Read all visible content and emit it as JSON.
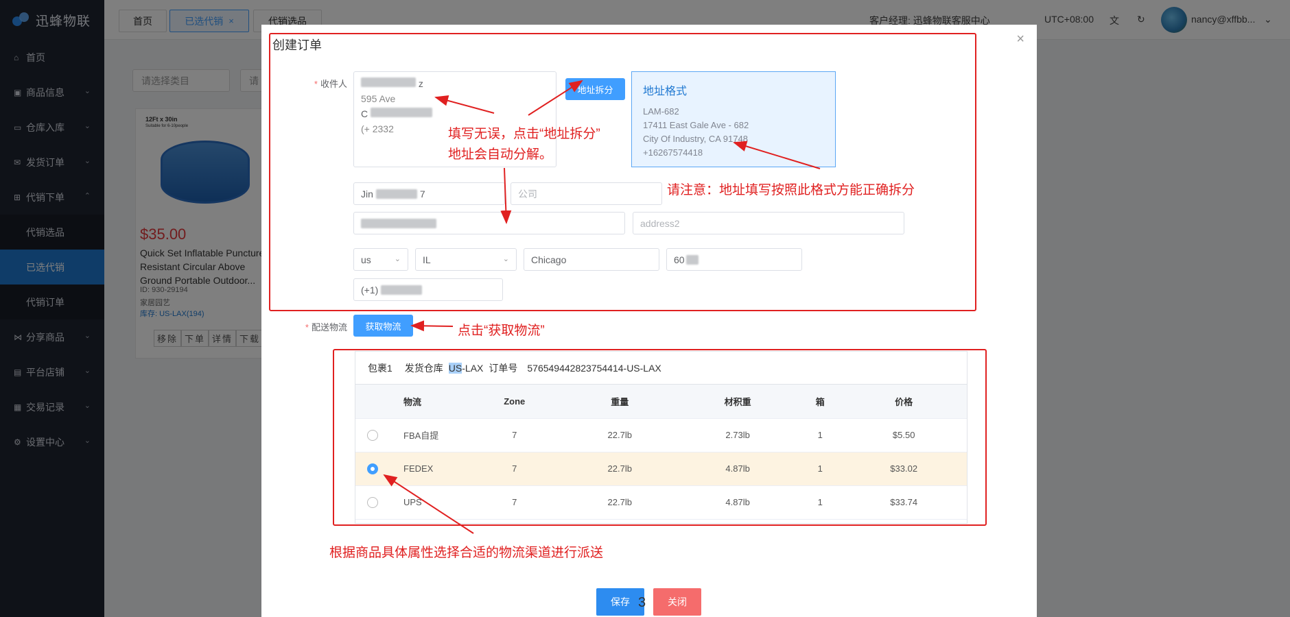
{
  "app": {
    "logo": "迅蜂物联"
  },
  "sidebar": {
    "items": [
      {
        "label": "首页",
        "icon": "home-icon"
      },
      {
        "label": "商品信息",
        "icon": "gift-icon"
      },
      {
        "label": "仓库入库",
        "icon": "folder-icon"
      },
      {
        "label": "发货订单",
        "icon": "mail-icon"
      },
      {
        "label": "代销下单",
        "icon": "cart-icon"
      }
    ],
    "subs": [
      {
        "label": "代销选品"
      },
      {
        "label": "已选代销"
      },
      {
        "label": "代销订单"
      }
    ],
    "items2": [
      {
        "label": "分享商品",
        "icon": "share-icon"
      },
      {
        "label": "平台店铺",
        "icon": "store-icon"
      },
      {
        "label": "交易记录",
        "icon": "document-icon"
      },
      {
        "label": "设置中心",
        "icon": "gear-icon"
      }
    ]
  },
  "topbar": {
    "tabs": [
      "首页",
      "已选代销",
      "代销选品"
    ],
    "manager": "客户经理: 迅蜂物联客服中心",
    "timezone": "UTC+08:00",
    "user": "nancy@xffbb...",
    "close_mark": "×"
  },
  "background": {
    "filter1": "请选择类目",
    "filter2": "请",
    "product": {
      "img_caption": "12Ft x 30in",
      "img_sub": "Suitable for 6-10people",
      "price": "$35.00",
      "title": "Quick Set Inflatable Puncture Resistant Circular Above Ground Portable Outdoor...",
      "id": "ID: 930-29194",
      "category": "家居园艺",
      "stock": "库存: US-LAX(194)",
      "actions": [
        "移除",
        "下单",
        "详情",
        "下载"
      ]
    }
  },
  "modal": {
    "title": "创建订单",
    "close": "×",
    "recipient_label": "收件人",
    "textarea_lines": [
      "z",
      "595          Ave",
      "C",
      "(+          2332"
    ],
    "split_button": "地址拆分",
    "format": {
      "title": "地址格式",
      "lines": [
        "LAM-682",
        "17411 East Gale Ave - 682",
        "City Of Industry, CA 91748",
        "+16267574418"
      ]
    },
    "name_prefix": "Jin",
    "name_suffix": "7",
    "company_placeholder": "公司",
    "address2_placeholder": "address2",
    "country": "us",
    "state": "IL",
    "city": "Chicago",
    "zip_prefix": "60",
    "phone_prefix": "(+1)",
    "shipping_label": "配送物流",
    "get_shipping_button": "获取物流",
    "package": {
      "parcel": "包裹1",
      "warehouse_label": "发货仓库",
      "warehouse_hl": "US",
      "warehouse_rest": "-LAX",
      "order_label": "订单号",
      "order_no": "576549442823754414-US-LAX"
    },
    "table": {
      "headers": [
        "物流",
        "Zone",
        "重量",
        "材积重",
        "箱",
        "价格"
      ],
      "rows": [
        {
          "carrier": "FBA自提",
          "zone": "7",
          "weight": "22.7lb",
          "vol": "2.73lb",
          "box": "1",
          "price": "$5.50",
          "selected": false
        },
        {
          "carrier": "FEDEX",
          "zone": "7",
          "weight": "22.7lb",
          "vol": "4.87lb",
          "box": "1",
          "price": "$33.02",
          "selected": true
        },
        {
          "carrier": "UPS",
          "zone": "7",
          "weight": "22.7lb",
          "vol": "4.87lb",
          "box": "1",
          "price": "$33.74",
          "selected": false
        }
      ]
    },
    "save": "保存",
    "close_btn": "关闭"
  },
  "annotations": {
    "note1_line1": "填写无误，点击“地址拆分”",
    "note1_line2": "地址会自动分解。",
    "note2": "请注意：地址填写按照此格式方能正确拆分",
    "note3": "点击“获取物流”",
    "note4": "根据商品具体属性选择合适的物流渠道进行派送",
    "color": "#e02020"
  },
  "page_number": "3",
  "colors": {
    "primary": "#409eff",
    "danger": "#f56c6c",
    "sidebar": "#1f2431",
    "active": "#1f78d1"
  }
}
